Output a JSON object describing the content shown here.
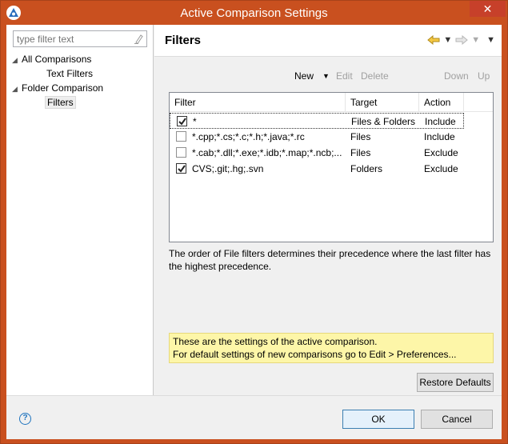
{
  "window": {
    "title": "Active Comparison Settings",
    "close_glyph": "✕",
    "accent_color": "#c9501f"
  },
  "left": {
    "filter_placeholder": "type filter text",
    "tree": [
      {
        "label": "All Comparisons",
        "level": 0,
        "expanded": true
      },
      {
        "label": "Text Filters",
        "level": 1
      },
      {
        "label": "Folder Comparison",
        "level": 0,
        "expanded": true
      },
      {
        "label": "Filters",
        "level": 1,
        "selected": true
      }
    ]
  },
  "page": {
    "title": "Filters"
  },
  "toolbar": {
    "new": "New",
    "edit": "Edit",
    "delete": "Delete",
    "down": "Down",
    "up": "Up"
  },
  "table": {
    "columns": [
      "Filter",
      "Target",
      "Action"
    ],
    "rows": [
      {
        "checked": true,
        "filter": "*",
        "target": "Files & Folders",
        "action": "Include"
      },
      {
        "checked": false,
        "filter": "*.cpp;*.cs;*.c;*.h;*.java;*.rc",
        "target": "Files",
        "action": "Include"
      },
      {
        "checked": false,
        "filter": "*.cab;*.dll;*.exe;*.idb;*.map;*.ncb;...",
        "target": "Files",
        "action": "Exclude"
      },
      {
        "checked": true,
        "filter": "CVS;.git;.hg;.svn",
        "target": "Folders",
        "action": "Exclude"
      }
    ]
  },
  "description": "The order of File filters determines their precedence where the last filter has the highest precedence.",
  "info": {
    "line1": "These are the settings of the active comparison.",
    "line2": "For default settings of new comparisons go to Edit > Preferences..."
  },
  "buttons": {
    "restore": "Restore Defaults",
    "ok": "OK",
    "cancel": "Cancel",
    "help": "?"
  }
}
